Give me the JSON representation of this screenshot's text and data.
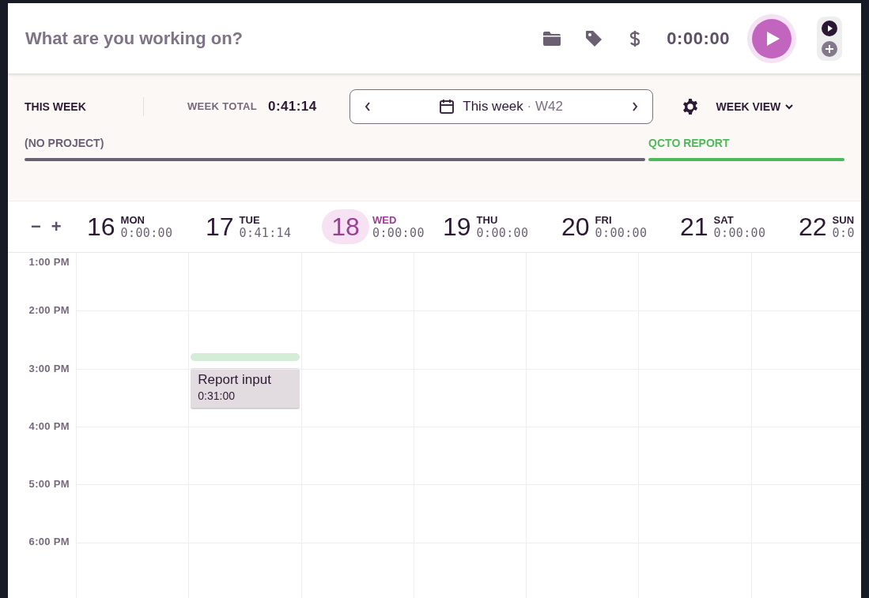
{
  "timer": {
    "placeholder": "What are you working on?",
    "time": "0:00:00"
  },
  "summary": {
    "label": "THIS WEEK",
    "total_label": "WEEK TOTAL",
    "total": "0:41:14",
    "range": "This week",
    "separator": "·",
    "week": "W42",
    "view": "WEEK VIEW"
  },
  "projects": [
    {
      "name": "(NO PROJECT)",
      "color": "#6b6175"
    },
    {
      "name": "QCTO REPORT",
      "color": "#4cba5a"
    }
  ],
  "modes": [
    {
      "kind": "timer",
      "selected": true
    },
    {
      "kind": "manual",
      "selected": false
    }
  ],
  "zoom": {
    "minus": "−",
    "plus": "+"
  },
  "days": [
    {
      "date": "16",
      "weekday": "MON",
      "total": "0:00:00",
      "selected": false
    },
    {
      "date": "17",
      "weekday": "TUE",
      "total": "0:41:14",
      "selected": false,
      "entries": [
        {
          "kind": "marker",
          "color": "#d5ecd6"
        },
        {
          "kind": "entry",
          "title": "Report input",
          "duration": "0:31:00"
        }
      ]
    },
    {
      "date": "18",
      "weekday": "WED",
      "total": "0:00:00",
      "selected": true
    },
    {
      "date": "19",
      "weekday": "THU",
      "total": "0:00:00",
      "selected": false
    },
    {
      "date": "20",
      "weekday": "FRI",
      "total": "0:00:00",
      "selected": false
    },
    {
      "date": "21",
      "weekday": "SAT",
      "total": "0:00:00",
      "selected": false
    },
    {
      "date": "22",
      "weekday": "SUN",
      "total": "0:0",
      "selected": false
    }
  ],
  "hours": [
    "1:00 PM",
    "2:00 PM",
    "3:00 PM",
    "4:00 PM",
    "5:00 PM",
    "6:00 PM"
  ]
}
